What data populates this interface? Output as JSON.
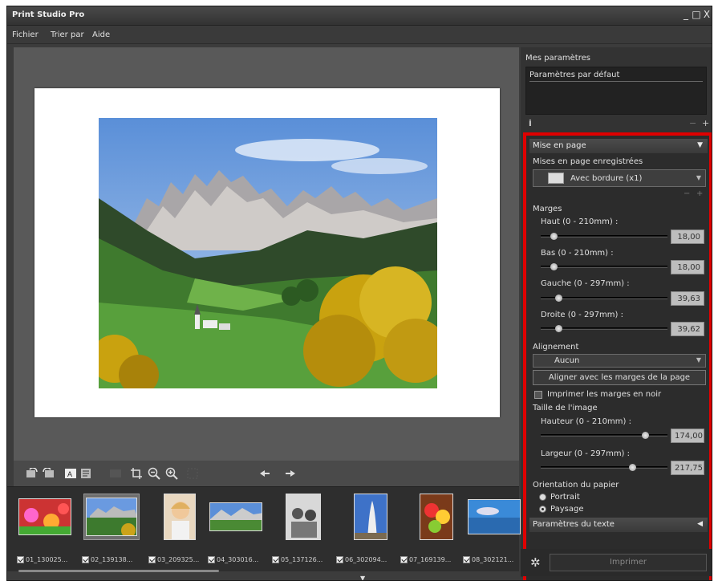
{
  "window": {
    "title": "Print Studio Pro",
    "controls": [
      "_",
      "□",
      "X"
    ]
  },
  "menu": [
    "Fichier",
    "Trier par",
    "Aide"
  ],
  "right_panel": {
    "my_params_title": "Mes paramètres",
    "my_params_item": "Paramètres par défaut",
    "info_icon": "i",
    "minus": "−",
    "plus": "+",
    "layout": {
      "header": "Mise en page",
      "saved_label": "Mises en page enregistrées",
      "saved_value": "Avec bordure (x1)",
      "minus": "−",
      "plus": "+",
      "margins_label": "Marges",
      "margins": [
        {
          "label": "Haut (0 - 210mm) :",
          "value": "18,00",
          "fraction": 0.07
        },
        {
          "label": "Bas (0 - 210mm) :",
          "value": "18,00",
          "fraction": 0.07
        },
        {
          "label": "Gauche (0 - 297mm) :",
          "value": "39,63",
          "fraction": 0.13
        },
        {
          "label": "Droite (0 - 297mm) :",
          "value": "39,62",
          "fraction": 0.13
        }
      ],
      "alignment_label": "Alignement",
      "alignment_value": "Aucun",
      "align_button": "Aligner avec les marges de la page",
      "print_margins_black": "Imprimer les marges en noir",
      "image_size_label": "Taille de l'image",
      "image_size": [
        {
          "label": "Hauteur (0 - 210mm) :",
          "value": "174,00",
          "fraction": 0.83
        },
        {
          "label": "Largeur (0 - 297mm) :",
          "value": "217,75",
          "fraction": 0.73
        }
      ],
      "orientation_label": "Orientation du papier",
      "portrait": "Portrait",
      "landscape": "Paysage",
      "text_params": "Paramètres du texte"
    },
    "print_button": "Imprimer"
  },
  "filmstrip": [
    {
      "caption": "01_130025..."
    },
    {
      "caption": "02_139138..."
    },
    {
      "caption": "03_209325..."
    },
    {
      "caption": "04_303016..."
    },
    {
      "caption": "05_137126..."
    },
    {
      "caption": "06_302094..."
    },
    {
      "caption": "07_169139..."
    },
    {
      "caption": "08_302121..."
    }
  ]
}
